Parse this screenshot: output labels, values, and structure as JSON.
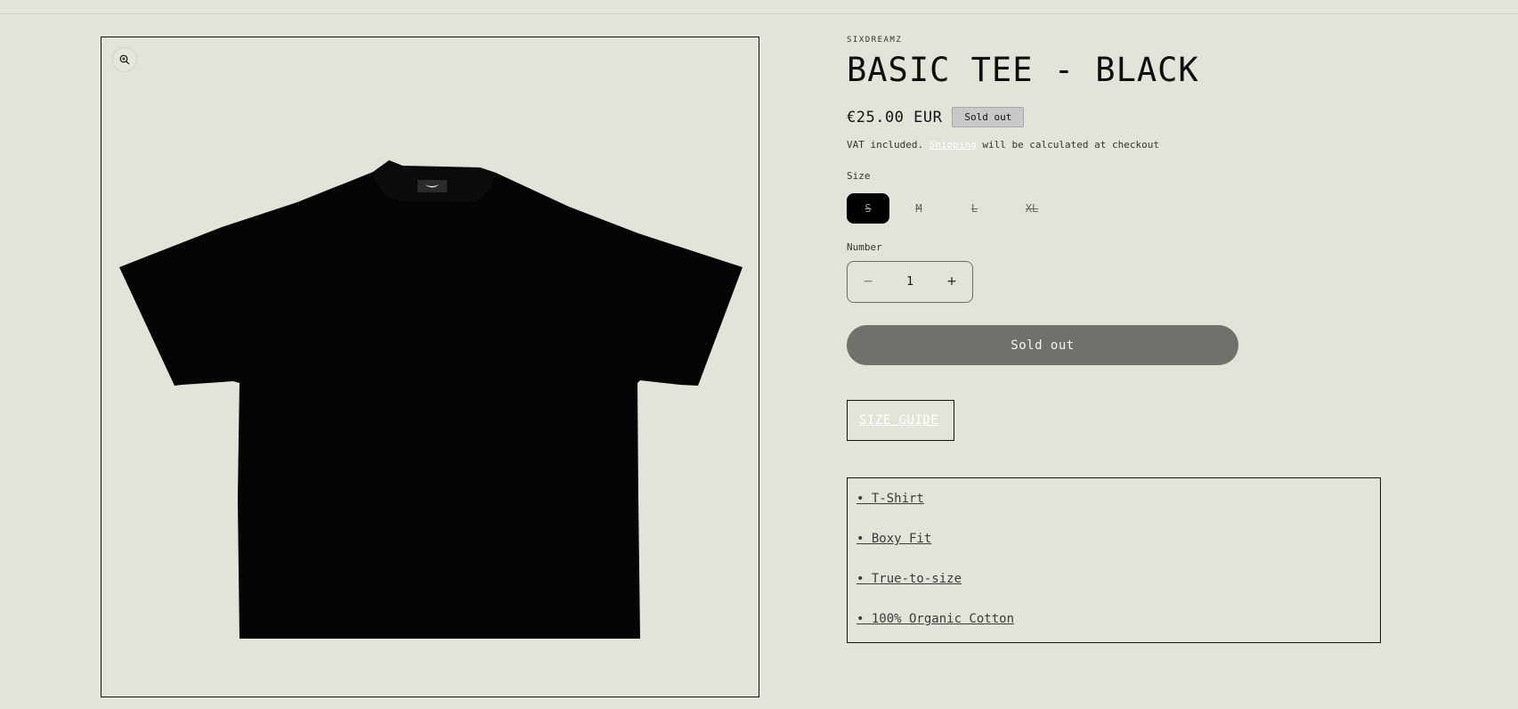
{
  "product": {
    "vendor": "SIXDREAMZ",
    "title": "BASIC TEE - BLACK",
    "price": "€25.00 EUR",
    "badge": "Sold out",
    "tax_prefix": "VAT included.",
    "shipping_link": "Shipping",
    "tax_suffix": "will be calculated at checkout"
  },
  "options": {
    "size_label": "Size",
    "sizes": [
      "S",
      "M",
      "L",
      "XL"
    ],
    "selected_size": "S",
    "quantity_label": "Number",
    "quantity": "1",
    "sold_out_button": "Sold out",
    "size_guide": "SIZE GUIDE"
  },
  "features": [
    "• T-Shirt",
    "• Boxy Fit",
    "• True-to-size",
    "• 100% Organic Cotton"
  ],
  "icons": {
    "zoom": "zoom-in-icon",
    "minus": "minus-icon",
    "plus": "plus-icon"
  },
  "colors": {
    "background": "#e3e3da",
    "button": "#71716c",
    "badge": "#c8c8c8"
  }
}
